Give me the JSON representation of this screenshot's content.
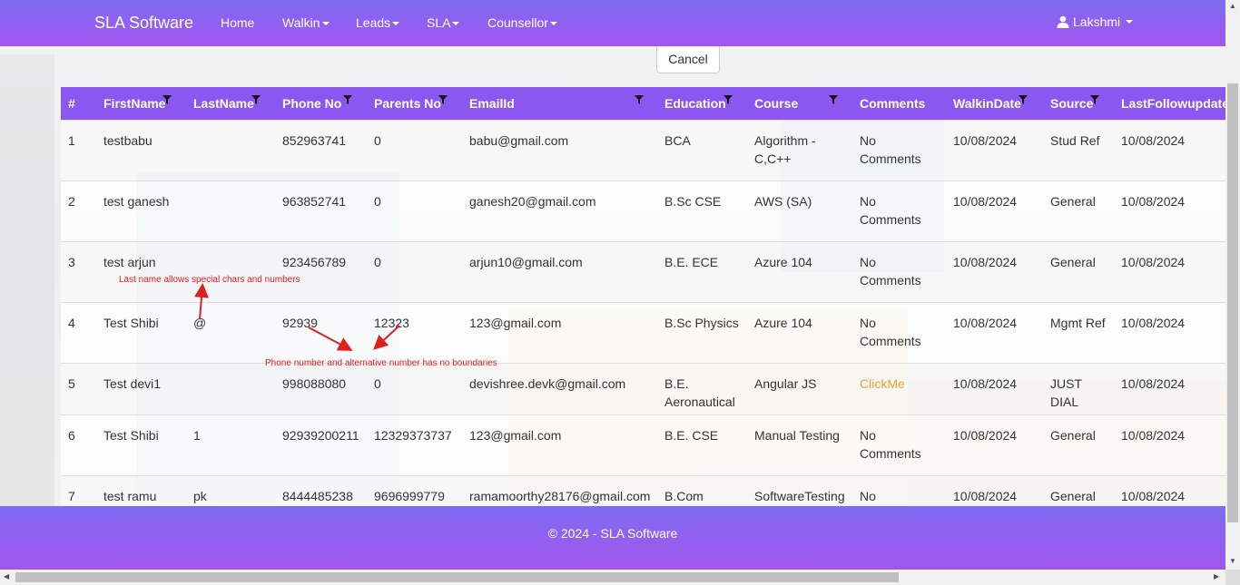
{
  "navbar": {
    "brand": "SLA Software",
    "items": [
      "Home",
      "Walkin",
      "Leads",
      "SLA",
      "Counsellor"
    ],
    "user": "Lakshmi"
  },
  "cancel_label": "Cancel",
  "table": {
    "headers": [
      "#",
      "FirstName",
      "LastName",
      "Phone No",
      "Parents No",
      "EmailId",
      "Education",
      "Course",
      "Comments",
      "WalkinDate",
      "Source",
      "LastFollowupdate"
    ],
    "rows": [
      [
        "1",
        "testbabu",
        "",
        "852963741",
        "0",
        "babu@gmail.com",
        "BCA",
        "Algorithm - C,C++",
        "No Comments",
        "10/08/2024",
        "Stud Ref",
        "10/08/2024"
      ],
      [
        "2",
        "test ganesh",
        "",
        "963852741",
        "0",
        "ganesh20@gmail.com",
        "B.Sc CSE",
        "AWS (SA)",
        "No Comments",
        "10/08/2024",
        "General",
        "10/08/2024"
      ],
      [
        "3",
        "test arjun",
        "",
        "923456789",
        "0",
        "arjun10@gmail.com",
        "B.E. ECE",
        "Azure 104",
        "No Comments",
        "10/08/2024",
        "General",
        "10/08/2024"
      ],
      [
        "4",
        "Test Shibi",
        "@",
        "92939",
        "12323",
        "123@gmail.com",
        "B.Sc Physics",
        "Azure 104",
        "No Comments",
        "10/08/2024",
        "Mgmt Ref",
        "10/08/2024"
      ],
      [
        "5",
        "Test devi1",
        "",
        "998088080",
        "0",
        "devishree.devk@gmail.com",
        "B.E. Aeronautical",
        "Angular JS",
        "ClickMe",
        "10/08/2024",
        "JUST DIAL",
        "10/08/2024"
      ],
      [
        "6",
        "Test Shibi",
        "1",
        "92939200211",
        "12329373737",
        "123@gmail.com",
        "B.E. CSE",
        "Manual Testing",
        "No Comments",
        "10/08/2024",
        "General",
        "10/08/2024"
      ],
      [
        "7",
        "test ramu",
        "pk",
        "8444485238",
        "9696999779",
        "ramamoorthy28176@gmail.com",
        "B.Com",
        "SoftwareTesting",
        "No",
        "10/08/2024",
        "General",
        "10/08/2024"
      ]
    ]
  },
  "annotations": {
    "lastname_note": "Last name allows special chars and numbers",
    "phone_note": "Phone number and alternative number has no boundaries"
  },
  "footer": "© 2024 - SLA Software",
  "colors": {
    "nav_gradient_start": "#7d6cf1",
    "nav_gradient_end": "#a355ee",
    "table_header": "#8b57f0",
    "annotation": "#e02020",
    "link_orange": "#f0a030"
  }
}
